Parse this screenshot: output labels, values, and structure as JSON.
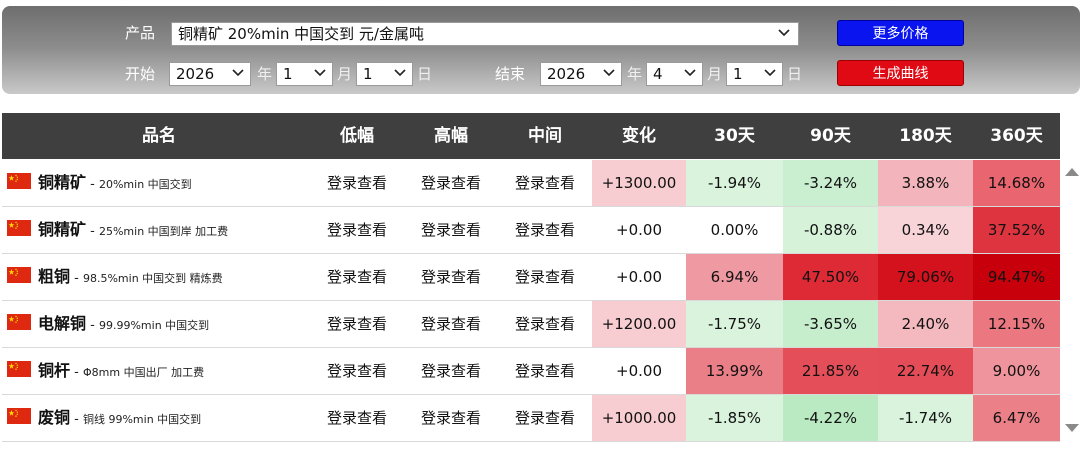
{
  "filter": {
    "product_label": "产品",
    "product_value": "铜精矿 20%min 中国交到 元/金属吨",
    "start_label": "开始",
    "end_label": "结束",
    "start": {
      "year": "2026",
      "month": "1",
      "day": "1"
    },
    "end": {
      "year": "2026",
      "month": "4",
      "day": "1"
    },
    "year_unit": "年",
    "month_unit": "月",
    "day_unit": "日",
    "more_prices_button": "更多价格",
    "generate_chart_button": "生成曲线"
  },
  "table": {
    "headers": [
      "品名",
      "低幅",
      "高幅",
      "中间",
      "变化",
      "30天",
      "90天",
      "180天",
      "360天"
    ],
    "rows": [
      {
        "name": "铜精矿",
        "spec": "20%min 中国交到",
        "low": "登录查看",
        "high": "登录查看",
        "mid": "登录查看",
        "change": "+1300.00",
        "d30": "-1.94%",
        "d90": "-3.24%",
        "d180": "3.88%",
        "d360": "14.68%"
      },
      {
        "name": "铜精矿",
        "spec": "25%min 中国到岸 加工费",
        "low": "登录查看",
        "high": "登录查看",
        "mid": "登录查看",
        "change": "+0.00",
        "d30": "0.00%",
        "d90": "-0.88%",
        "d180": "0.34%",
        "d360": "37.52%"
      },
      {
        "name": "粗铜",
        "spec": "98.5%min 中国交到 精炼费",
        "low": "登录查看",
        "high": "登录查看",
        "mid": "登录查看",
        "change": "+0.00",
        "d30": "6.94%",
        "d90": "47.50%",
        "d180": "79.06%",
        "d360": "94.47%"
      },
      {
        "name": "电解铜",
        "spec": "99.99%min 中国交到",
        "low": "登录查看",
        "high": "登录查看",
        "mid": "登录查看",
        "change": "+1200.00",
        "d30": "-1.75%",
        "d90": "-3.65%",
        "d180": "2.40%",
        "d360": "12.15%"
      },
      {
        "name": "铜杆",
        "spec": "Φ8mm 中国出厂 加工费",
        "low": "登录查看",
        "high": "登录查看",
        "mid": "登录查看",
        "change": "+0.00",
        "d30": "13.99%",
        "d90": "21.85%",
        "d180": "22.74%",
        "d360": "9.00%"
      },
      {
        "name": "废铜",
        "spec": "铜线 99%min 中国交到",
        "low": "登录查看",
        "high": "登录查看",
        "mid": "登录查看",
        "change": "+1000.00",
        "d30": "-1.85%",
        "d90": "-4.22%",
        "d180": "-1.74%",
        "d360": "6.47%"
      }
    ],
    "cell_colors": [
      {
        "change": "#f8cdd2",
        "d30": "#d9f3dd",
        "d90": "#c9efd0",
        "d180": "#f3b5bb",
        "d360": "#e9656f"
      },
      {
        "change": "#ffffff",
        "d30": "#ffffff",
        "d90": "#d6f3da",
        "d180": "#f8d3d7",
        "d360": "#de3440"
      },
      {
        "change": "#ffffff",
        "d30": "#ef9aa2",
        "d90": "#dd2a35",
        "d180": "#d4121d",
        "d360": "#c8000b"
      },
      {
        "change": "#f8cdd2",
        "d30": "#d9f3dd",
        "d90": "#c6eecd",
        "d180": "#f3b9bf",
        "d360": "#eb7780"
      },
      {
        "change": "#ffffff",
        "d30": "#eb7f88",
        "d90": "#e44e59",
        "d180": "#e44d57",
        "d360": "#ef949c"
      },
      {
        "change": "#f8cdd2",
        "d30": "#d9f3dd",
        "d90": "#b9eac1",
        "d180": "#d9f3dd",
        "d360": "#ec8089"
      }
    ],
    "flag_icon": "china-flag-icon",
    "colors": {
      "header_bg": "#3f3f3f",
      "blue_button": "#0a14ee",
      "red_button": "#e00a14"
    }
  }
}
